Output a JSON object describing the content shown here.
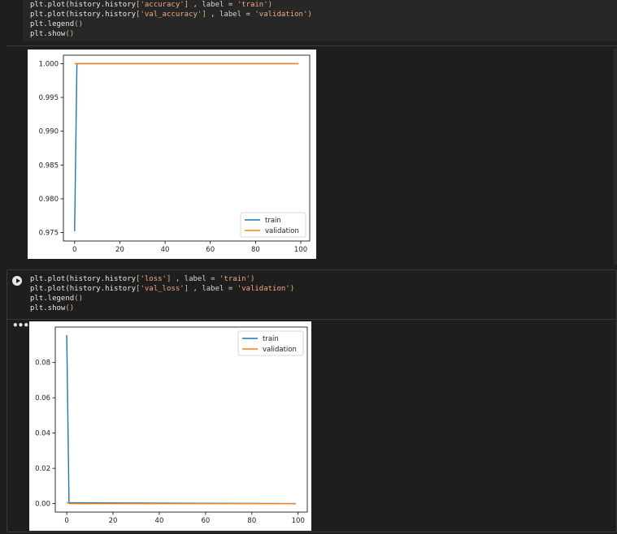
{
  "cell1": {
    "code": [
      {
        "parts": [
          {
            "t": "plt.plot(history.history",
            "c": "t-fn"
          },
          {
            "t": "[",
            "c": "t-br"
          },
          {
            "t": "'accuracy'",
            "c": "t-str"
          },
          {
            "t": "]",
            "c": "t-br"
          },
          {
            "t": " , label = ",
            "c": "t-plain"
          },
          {
            "t": "'train'",
            "c": "t-str"
          },
          {
            "t": ")",
            "c": "t-br"
          }
        ]
      },
      {
        "parts": [
          {
            "t": "plt.plot(history.history",
            "c": "t-fn"
          },
          {
            "t": "[",
            "c": "t-br"
          },
          {
            "t": "'val_accuracy'",
            "c": "t-str"
          },
          {
            "t": "]",
            "c": "t-br"
          },
          {
            "t": " , label = ",
            "c": "t-plain"
          },
          {
            "t": "'validation'",
            "c": "t-str"
          },
          {
            "t": ")",
            "c": "t-br"
          }
        ]
      },
      {
        "parts": [
          {
            "t": "plt.legend",
            "c": "t-fn"
          },
          {
            "t": "()",
            "c": "t-br"
          }
        ]
      },
      {
        "parts": [
          {
            "t": "plt.show",
            "c": "t-fn"
          },
          {
            "t": "()",
            "c": "t-br"
          }
        ]
      }
    ]
  },
  "cell2": {
    "code": [
      {
        "parts": [
          {
            "t": "plt.plot(history.history",
            "c": "t-fn"
          },
          {
            "t": "[",
            "c": "t-br"
          },
          {
            "t": "'loss'",
            "c": "t-str"
          },
          {
            "t": "]",
            "c": "t-br"
          },
          {
            "t": " , label = ",
            "c": "t-plain"
          },
          {
            "t": "'train'",
            "c": "t-str"
          },
          {
            "t": ")",
            "c": "t-br"
          }
        ]
      },
      {
        "parts": [
          {
            "t": "plt.plot(history.history",
            "c": "t-fn"
          },
          {
            "t": "[",
            "c": "t-br"
          },
          {
            "t": "'val_loss'",
            "c": "t-str"
          },
          {
            "t": "]",
            "c": "t-br"
          },
          {
            "t": " , label = ",
            "c": "t-plain"
          },
          {
            "t": "'validation'",
            "c": "t-str"
          },
          {
            "t": ")",
            "c": "t-br"
          }
        ]
      },
      {
        "parts": [
          {
            "t": "plt.legend",
            "c": "t-fn"
          },
          {
            "t": "()",
            "c": "t-br"
          }
        ]
      },
      {
        "parts": [
          {
            "t": "plt.show",
            "c": "t-fn"
          },
          {
            "t": "()",
            "c": "t-br"
          }
        ]
      }
    ]
  },
  "output_menu_icon": "ellipsis-icon",
  "run_icon": "play-icon",
  "colors": {
    "train": "#1f77b4",
    "validation": "#ff7f0e"
  },
  "chart_data": [
    {
      "type": "line",
      "title": "",
      "xlabel": "",
      "ylabel": "",
      "xlim": [
        -4.95,
        103.95
      ],
      "ylim": [
        0.97375,
        1.00125
      ],
      "xticks": [
        0,
        20,
        40,
        60,
        80,
        100
      ],
      "yticks": [
        "0.975",
        "0.980",
        "0.985",
        "0.990",
        "0.995",
        "1.000"
      ],
      "ytick_values": [
        0.975,
        0.98,
        0.985,
        0.99,
        0.995,
        1.0
      ],
      "legend_position": "lower-right",
      "series": [
        {
          "name": "train",
          "color": "#1f77b4",
          "x": [
            0,
            1,
            99
          ],
          "y": [
            0.9752,
            1.0,
            1.0
          ]
        },
        {
          "name": "validation",
          "color": "#ff7f0e",
          "x": [
            0,
            99
          ],
          "y": [
            1.0,
            1.0
          ]
        }
      ]
    },
    {
      "type": "line",
      "title": "",
      "xlabel": "",
      "ylabel": "",
      "xlim": [
        -4.95,
        103.95
      ],
      "ylim": [
        -0.0048,
        0.1001
      ],
      "xticks": [
        0,
        20,
        40,
        60,
        80,
        100
      ],
      "yticks": [
        "0.00",
        "0.02",
        "0.04",
        "0.06",
        "0.08"
      ],
      "ytick_values": [
        0.0,
        0.02,
        0.04,
        0.06,
        0.08
      ],
      "legend_position": "upper-right",
      "series": [
        {
          "name": "train",
          "color": "#1f77b4",
          "x": [
            0,
            1,
            99
          ],
          "y": [
            0.0955,
            0.0005,
            0.0
          ]
        },
        {
          "name": "validation",
          "color": "#ff7f0e",
          "x": [
            0,
            1,
            99
          ],
          "y": [
            0.0008,
            0.0,
            0.0
          ]
        }
      ]
    }
  ]
}
